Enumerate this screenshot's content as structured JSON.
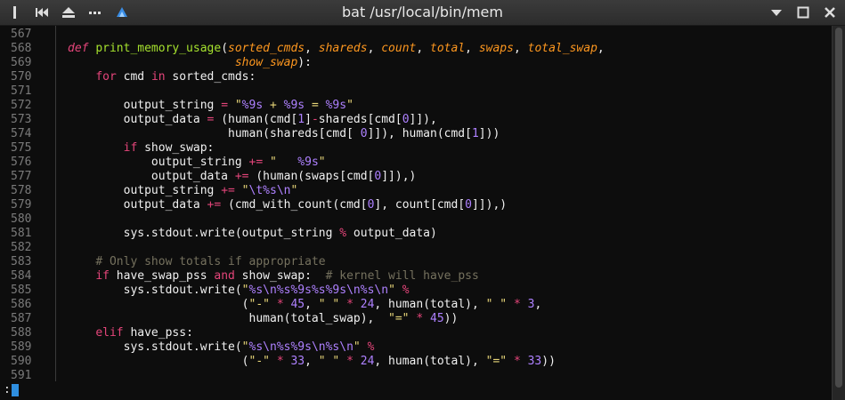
{
  "window": {
    "title": "bat /usr/local/bin/mem"
  },
  "colors": {
    "keyword": "#e4457a",
    "string": "#e8d679",
    "number": "#ae81ff",
    "param": "#fd971f",
    "comment": "#75715e",
    "func": "#a6e22e",
    "text": "#f0f0f0",
    "linenum": "#7a7a7a"
  },
  "icons": [
    "pin-icon",
    "rewind-icon",
    "eject-icon",
    "menu-dots-icon",
    "app-icon",
    "minimize-icon",
    "maximize-icon",
    "close-icon"
  ],
  "lines": [
    {
      "n": "567",
      "tokens": []
    },
    {
      "n": "568",
      "tokens": [
        {
          "t": "def ",
          "c": "keyword",
          "i": true
        },
        {
          "t": "print_memory_usage",
          "c": "func"
        },
        {
          "t": "(",
          "c": "text"
        },
        {
          "t": "sorted_cmds",
          "c": "param",
          "i": true
        },
        {
          "t": ", ",
          "c": "text"
        },
        {
          "t": "shareds",
          "c": "param",
          "i": true
        },
        {
          "t": ", ",
          "c": "text"
        },
        {
          "t": "count",
          "c": "param",
          "i": true
        },
        {
          "t": ", ",
          "c": "text"
        },
        {
          "t": "total",
          "c": "param",
          "i": true
        },
        {
          "t": ", ",
          "c": "text"
        },
        {
          "t": "swaps",
          "c": "param",
          "i": true
        },
        {
          "t": ", ",
          "c": "text"
        },
        {
          "t": "total_swap",
          "c": "param",
          "i": true
        },
        {
          "t": ",",
          "c": "text"
        }
      ]
    },
    {
      "n": "569",
      "tokens": [
        {
          "t": "                        ",
          "c": "text"
        },
        {
          "t": "show_swap",
          "c": "param",
          "i": true
        },
        {
          "t": "):",
          "c": "text"
        }
      ]
    },
    {
      "n": "570",
      "tokens": [
        {
          "t": "    ",
          "c": "text"
        },
        {
          "t": "for",
          "c": "keyword"
        },
        {
          "t": " cmd ",
          "c": "text"
        },
        {
          "t": "in",
          "c": "keyword"
        },
        {
          "t": " sorted_cmds:",
          "c": "text"
        }
      ]
    },
    {
      "n": "571",
      "tokens": []
    },
    {
      "n": "572",
      "tokens": [
        {
          "t": "        output_string ",
          "c": "text"
        },
        {
          "t": "=",
          "c": "keyword"
        },
        {
          "t": " ",
          "c": "text"
        },
        {
          "t": "\"",
          "c": "string"
        },
        {
          "t": "%9s",
          "c": "number"
        },
        {
          "t": " + ",
          "c": "string"
        },
        {
          "t": "%9s",
          "c": "number"
        },
        {
          "t": " = ",
          "c": "string"
        },
        {
          "t": "%9s",
          "c": "number"
        },
        {
          "t": "\"",
          "c": "string"
        }
      ]
    },
    {
      "n": "573",
      "tokens": [
        {
          "t": "        output_data ",
          "c": "text"
        },
        {
          "t": "=",
          "c": "keyword"
        },
        {
          "t": " (human(cmd[",
          "c": "text"
        },
        {
          "t": "1",
          "c": "number"
        },
        {
          "t": "]",
          "c": "text"
        },
        {
          "t": "-",
          "c": "keyword"
        },
        {
          "t": "shareds[cmd[",
          "c": "text"
        },
        {
          "t": "0",
          "c": "number"
        },
        {
          "t": "]]),",
          "c": "text"
        }
      ]
    },
    {
      "n": "574",
      "tokens": [
        {
          "t": "                       human(shareds[cmd[ ",
          "c": "text"
        },
        {
          "t": "0",
          "c": "number"
        },
        {
          "t": "]]), human(cmd[",
          "c": "text"
        },
        {
          "t": "1",
          "c": "number"
        },
        {
          "t": "]))",
          "c": "text"
        }
      ]
    },
    {
      "n": "575",
      "tokens": [
        {
          "t": "        ",
          "c": "text"
        },
        {
          "t": "if",
          "c": "keyword"
        },
        {
          "t": " show_swap:",
          "c": "text"
        }
      ]
    },
    {
      "n": "576",
      "tokens": [
        {
          "t": "            output_string ",
          "c": "text"
        },
        {
          "t": "+=",
          "c": "keyword"
        },
        {
          "t": " ",
          "c": "text"
        },
        {
          "t": "\"   ",
          "c": "string"
        },
        {
          "t": "%9s",
          "c": "number"
        },
        {
          "t": "\"",
          "c": "string"
        }
      ]
    },
    {
      "n": "577",
      "tokens": [
        {
          "t": "            output_data ",
          "c": "text"
        },
        {
          "t": "+=",
          "c": "keyword"
        },
        {
          "t": " (human(swaps[cmd[",
          "c": "text"
        },
        {
          "t": "0",
          "c": "number"
        },
        {
          "t": "]]),)",
          "c": "text"
        }
      ]
    },
    {
      "n": "578",
      "tokens": [
        {
          "t": "        output_string ",
          "c": "text"
        },
        {
          "t": "+=",
          "c": "keyword"
        },
        {
          "t": " ",
          "c": "text"
        },
        {
          "t": "\"",
          "c": "string"
        },
        {
          "t": "\\t",
          "c": "number"
        },
        {
          "t": "%s",
          "c": "number"
        },
        {
          "t": "\\n",
          "c": "number"
        },
        {
          "t": "\"",
          "c": "string"
        }
      ]
    },
    {
      "n": "579",
      "tokens": [
        {
          "t": "        output_data ",
          "c": "text"
        },
        {
          "t": "+=",
          "c": "keyword"
        },
        {
          "t": " (cmd_with_count(cmd[",
          "c": "text"
        },
        {
          "t": "0",
          "c": "number"
        },
        {
          "t": "], count[cmd[",
          "c": "text"
        },
        {
          "t": "0",
          "c": "number"
        },
        {
          "t": "]]),)",
          "c": "text"
        }
      ]
    },
    {
      "n": "580",
      "tokens": []
    },
    {
      "n": "581",
      "tokens": [
        {
          "t": "        sys.stdout.write(output_string ",
          "c": "text"
        },
        {
          "t": "%",
          "c": "keyword"
        },
        {
          "t": " output_data)",
          "c": "text"
        }
      ]
    },
    {
      "n": "582",
      "tokens": []
    },
    {
      "n": "583",
      "tokens": [
        {
          "t": "    ",
          "c": "text"
        },
        {
          "t": "# Only show totals if appropriate",
          "c": "comment"
        }
      ]
    },
    {
      "n": "584",
      "tokens": [
        {
          "t": "    ",
          "c": "text"
        },
        {
          "t": "if",
          "c": "keyword"
        },
        {
          "t": " have_swap_pss ",
          "c": "text"
        },
        {
          "t": "and",
          "c": "keyword"
        },
        {
          "t": " show_swap:  ",
          "c": "text"
        },
        {
          "t": "# kernel will have_pss",
          "c": "comment"
        }
      ]
    },
    {
      "n": "585",
      "tokens": [
        {
          "t": "        sys.stdout.write(",
          "c": "text"
        },
        {
          "t": "\"",
          "c": "string"
        },
        {
          "t": "%s",
          "c": "number"
        },
        {
          "t": "\\n",
          "c": "number"
        },
        {
          "t": "%s",
          "c": "number"
        },
        {
          "t": "%9s",
          "c": "number"
        },
        {
          "t": "%s",
          "c": "number"
        },
        {
          "t": "%9s",
          "c": "number"
        },
        {
          "t": "\\n",
          "c": "number"
        },
        {
          "t": "%s",
          "c": "number"
        },
        {
          "t": "\\n",
          "c": "number"
        },
        {
          "t": "\"",
          "c": "string"
        },
        {
          "t": " ",
          "c": "text"
        },
        {
          "t": "%",
          "c": "keyword"
        }
      ]
    },
    {
      "n": "586",
      "tokens": [
        {
          "t": "                         (",
          "c": "text"
        },
        {
          "t": "\"-\"",
          "c": "string"
        },
        {
          "t": " ",
          "c": "text"
        },
        {
          "t": "*",
          "c": "keyword"
        },
        {
          "t": " ",
          "c": "text"
        },
        {
          "t": "45",
          "c": "number"
        },
        {
          "t": ", ",
          "c": "text"
        },
        {
          "t": "\" \"",
          "c": "string"
        },
        {
          "t": " ",
          "c": "text"
        },
        {
          "t": "*",
          "c": "keyword"
        },
        {
          "t": " ",
          "c": "text"
        },
        {
          "t": "24",
          "c": "number"
        },
        {
          "t": ", human(total), ",
          "c": "text"
        },
        {
          "t": "\" \"",
          "c": "string"
        },
        {
          "t": " ",
          "c": "text"
        },
        {
          "t": "*",
          "c": "keyword"
        },
        {
          "t": " ",
          "c": "text"
        },
        {
          "t": "3",
          "c": "number"
        },
        {
          "t": ",",
          "c": "text"
        }
      ]
    },
    {
      "n": "587",
      "tokens": [
        {
          "t": "                          human(total_swap),  ",
          "c": "text"
        },
        {
          "t": "\"=\"",
          "c": "string"
        },
        {
          "t": " ",
          "c": "text"
        },
        {
          "t": "*",
          "c": "keyword"
        },
        {
          "t": " ",
          "c": "text"
        },
        {
          "t": "45",
          "c": "number"
        },
        {
          "t": "))",
          "c": "text"
        }
      ]
    },
    {
      "n": "588",
      "tokens": [
        {
          "t": "    ",
          "c": "text"
        },
        {
          "t": "elif",
          "c": "keyword"
        },
        {
          "t": " have_pss:",
          "c": "text"
        }
      ]
    },
    {
      "n": "589",
      "tokens": [
        {
          "t": "        sys.stdout.write(",
          "c": "text"
        },
        {
          "t": "\"",
          "c": "string"
        },
        {
          "t": "%s",
          "c": "number"
        },
        {
          "t": "\\n",
          "c": "number"
        },
        {
          "t": "%s",
          "c": "number"
        },
        {
          "t": "%9s",
          "c": "number"
        },
        {
          "t": "\\n",
          "c": "number"
        },
        {
          "t": "%s",
          "c": "number"
        },
        {
          "t": "\\n",
          "c": "number"
        },
        {
          "t": "\"",
          "c": "string"
        },
        {
          "t": " ",
          "c": "text"
        },
        {
          "t": "%",
          "c": "keyword"
        }
      ]
    },
    {
      "n": "590",
      "tokens": [
        {
          "t": "                         (",
          "c": "text"
        },
        {
          "t": "\"-\"",
          "c": "string"
        },
        {
          "t": " ",
          "c": "text"
        },
        {
          "t": "*",
          "c": "keyword"
        },
        {
          "t": " ",
          "c": "text"
        },
        {
          "t": "33",
          "c": "number"
        },
        {
          "t": ", ",
          "c": "text"
        },
        {
          "t": "\" \"",
          "c": "string"
        },
        {
          "t": " ",
          "c": "text"
        },
        {
          "t": "*",
          "c": "keyword"
        },
        {
          "t": " ",
          "c": "text"
        },
        {
          "t": "24",
          "c": "number"
        },
        {
          "t": ", human(total), ",
          "c": "text"
        },
        {
          "t": "\"=\"",
          "c": "string"
        },
        {
          "t": " ",
          "c": "text"
        },
        {
          "t": "*",
          "c": "keyword"
        },
        {
          "t": " ",
          "c": "text"
        },
        {
          "t": "33",
          "c": "number"
        },
        {
          "t": "))",
          "c": "text"
        }
      ]
    },
    {
      "n": "591",
      "tokens": []
    }
  ],
  "prompt": ":"
}
